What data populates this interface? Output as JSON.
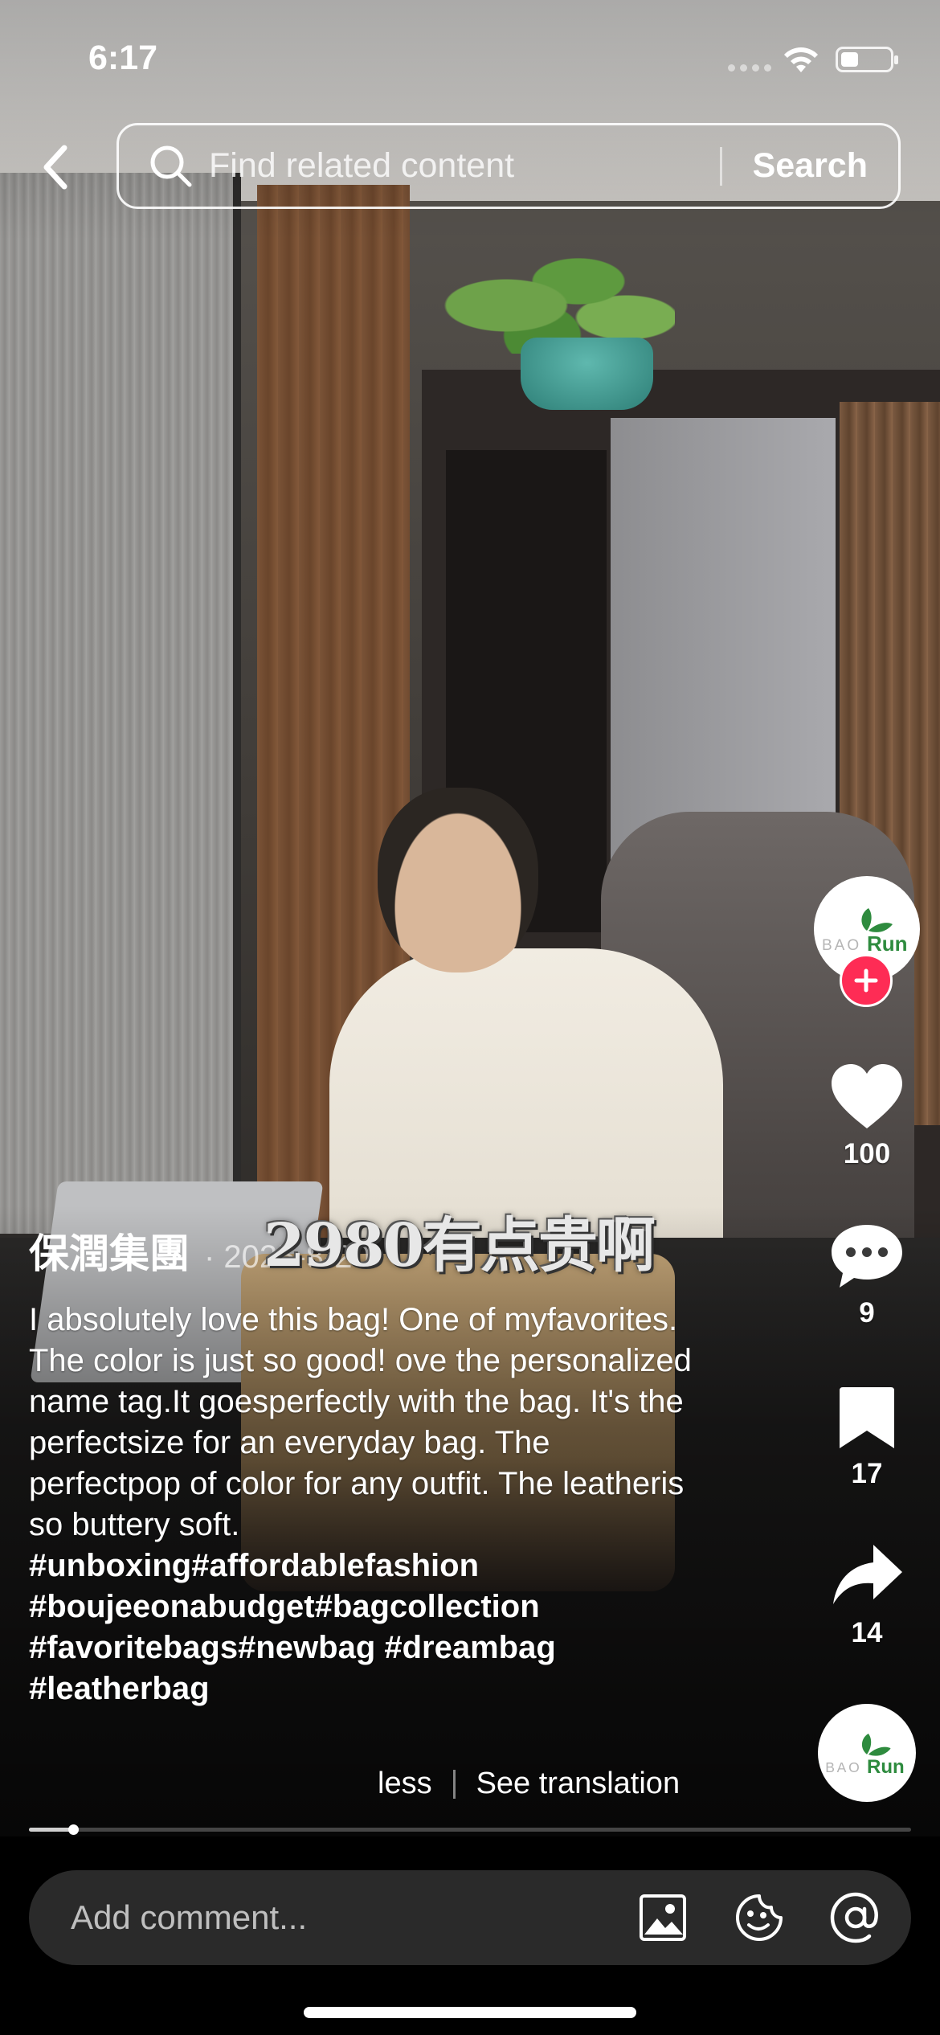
{
  "status_bar": {
    "time": "6:17",
    "battery_level": 0.35
  },
  "search": {
    "placeholder": "Find related content",
    "button_label": "Search"
  },
  "video": {
    "overlay_caption": "2980有点贵啊"
  },
  "creator": {
    "name": "保潤集團",
    "date": "· 2025-8-20",
    "avatar_text_left": "BAO",
    "avatar_text_right": "Run"
  },
  "actions": {
    "likes": "100",
    "comments": "9",
    "saves": "17",
    "shares": "14"
  },
  "caption": {
    "text": "I absolutely love this bag! One of myfavorites. The color is just so good! ove the personalized name tag.It goesperfectly with the bag. It's the perfectsize for an everyday bag. The perfectpop of color for any outfit. The leatheris so buttery soft.",
    "hashtags": "#unboxing#affordablefashion #boujeeonabudget#bagcollection #favoritebags#newbag #dreambag #leatherbag",
    "less_label": "less",
    "translation_label": "See translation"
  },
  "progress": {
    "fraction": 0.05
  },
  "comment_bar": {
    "placeholder": "Add comment..."
  },
  "colors": {
    "follow_accent": "#fe2c55",
    "logo_green": "#2e8b3e"
  }
}
